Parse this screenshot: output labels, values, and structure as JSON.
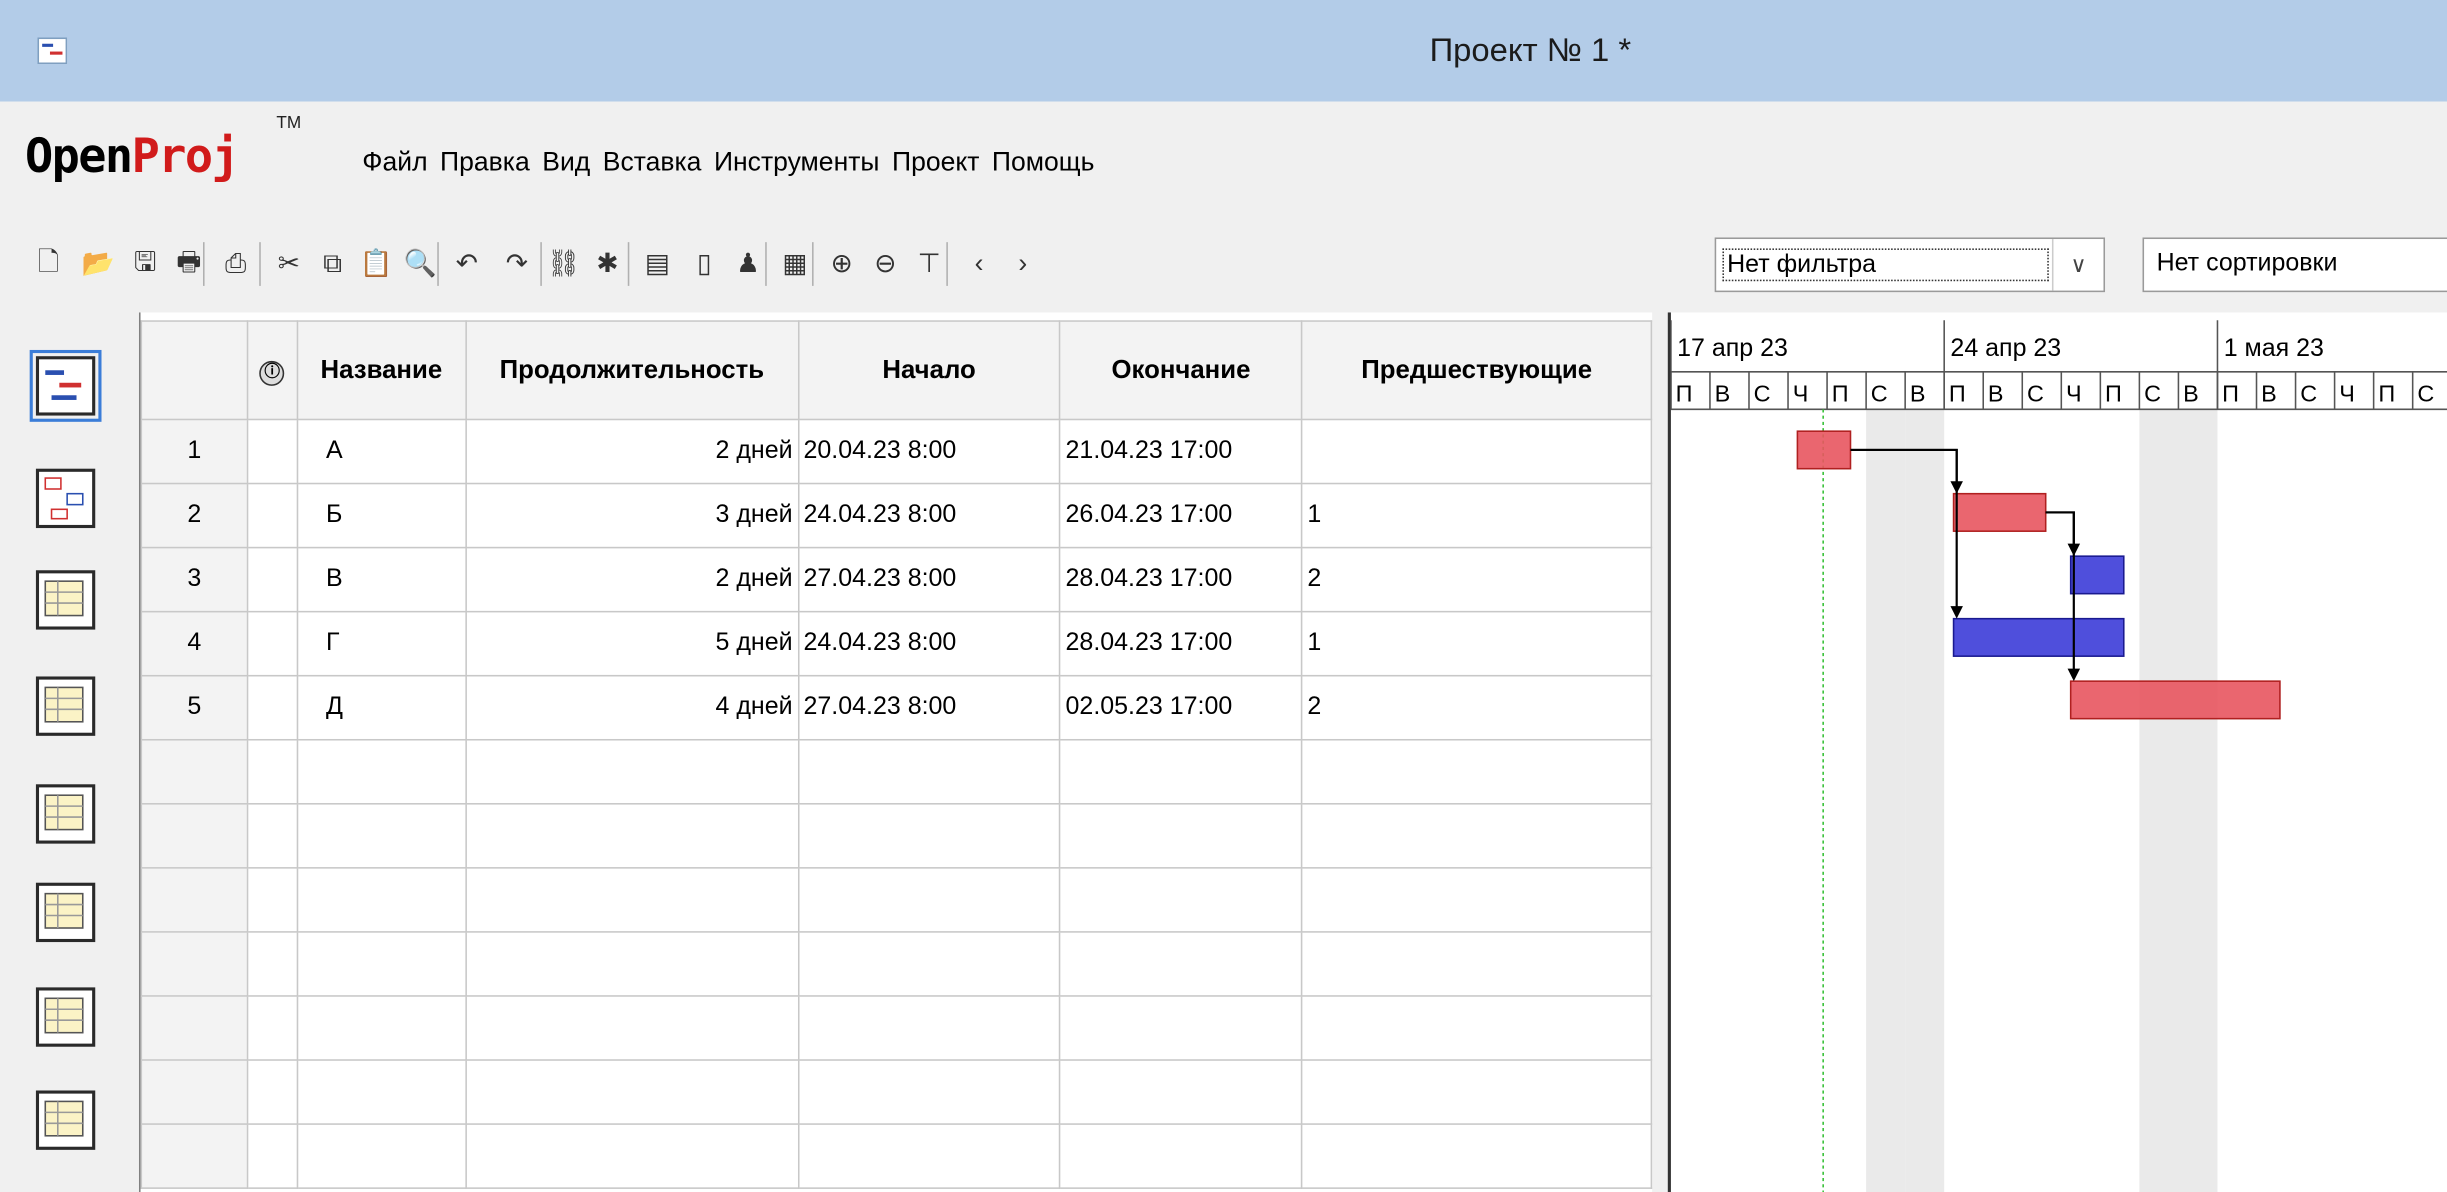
{
  "window": {
    "title": "Проект № 1 *"
  },
  "logo": {
    "part1": "Open",
    "part2": "Proj",
    "tm": "TM"
  },
  "menu": [
    "Файл",
    "Правка",
    "Вид",
    "Вставка",
    "Инструменты",
    "Проект",
    "Помощь"
  ],
  "toolbar": {
    "icons": [
      "new-document-icon",
      "open-folder-icon",
      "save-icon",
      "print-icon",
      "print-preview-icon",
      "cut-icon",
      "copy-icon",
      "paste-icon",
      "find-icon",
      "undo-icon",
      "redo-icon",
      "link-icon",
      "unlink-icon",
      "task-info-icon",
      "notes-icon",
      "assign-resource-icon",
      "calendar-icon",
      "zoom-in-icon",
      "zoom-out-icon",
      "filter-icon",
      "scroll-left-icon",
      "scroll-right-icon"
    ],
    "filter": "Нет фильтра",
    "sort": "Нет сортировки"
  },
  "views": [
    "gantt-view-icon",
    "network-view-icon",
    "resource-table-icon",
    "wbs-view-icon",
    "rbs-view-icon",
    "report-view-icon",
    "task-usage-icon",
    "resource-usage-icon"
  ],
  "table": {
    "headers": {
      "indicator": "ⓘ",
      "name": "Название",
      "duration": "Продолжительность",
      "start": "Начало",
      "finish": "Окончание",
      "predecessors": "Предшествующие"
    },
    "rows": [
      {
        "n": "1",
        "name": "А",
        "duration": "2 дней",
        "start": "20.04.23 8:00",
        "finish": "21.04.23 17:00",
        "pred": ""
      },
      {
        "n": "2",
        "name": "Б",
        "duration": "3 дней",
        "start": "24.04.23 8:00",
        "finish": "26.04.23 17:00",
        "pred": "1"
      },
      {
        "n": "3",
        "name": "В",
        "duration": "2 дней",
        "start": "27.04.23 8:00",
        "finish": "28.04.23 17:00",
        "pred": "2"
      },
      {
        "n": "4",
        "name": "Г",
        "duration": "5 дней",
        "start": "24.04.23 8:00",
        "finish": "28.04.23 17:00",
        "pred": "1"
      },
      {
        "n": "5",
        "name": "Д",
        "duration": "4 дней",
        "start": "27.04.23 8:00",
        "finish": "02.05.23 17:00",
        "pred": "2"
      }
    ]
  },
  "gantt": {
    "weeks": [
      "17 апр 23",
      "24 апр 23",
      "1 мая 23"
    ],
    "days": [
      "П",
      "В",
      "С",
      "Ч",
      "П",
      "С",
      "В",
      "П",
      "В",
      "С",
      "Ч",
      "П",
      "С",
      "В",
      "П",
      "В",
      "С",
      "Ч",
      "П",
      "С"
    ],
    "colors": {
      "normal": "#e8555f",
      "critical": "#3c3cd8",
      "weekend": "#d8d8d8",
      "today": "#35c035"
    },
    "bars": [
      {
        "task": "А",
        "start": "2023-04-20",
        "end": "2023-04-21",
        "type": "normal"
      },
      {
        "task": "Б",
        "start": "2023-04-24",
        "end": "2023-04-26",
        "type": "normal"
      },
      {
        "task": "В",
        "start": "2023-04-27",
        "end": "2023-04-28",
        "type": "critical"
      },
      {
        "task": "Г",
        "start": "2023-04-24",
        "end": "2023-04-28",
        "type": "critical"
      },
      {
        "task": "Д",
        "start": "2023-04-27",
        "end": "2023-05-02",
        "type": "normal"
      }
    ],
    "links": [
      {
        "from": "А",
        "to": "Б"
      },
      {
        "from": "А",
        "to": "Г"
      },
      {
        "from": "Б",
        "to": "В"
      },
      {
        "from": "Б",
        "to": "Д"
      }
    ]
  }
}
